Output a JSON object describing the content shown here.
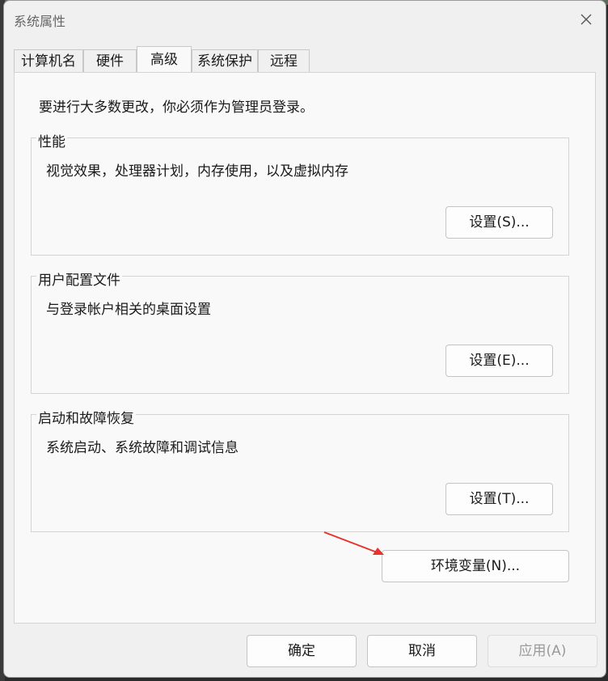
{
  "window": {
    "title": "系统属性",
    "close_icon": "close-icon"
  },
  "tabs": [
    {
      "label": "计算机名",
      "active": false
    },
    {
      "label": "硬件",
      "active": false
    },
    {
      "label": "高级",
      "active": true
    },
    {
      "label": "系统保护",
      "active": false
    },
    {
      "label": "远程",
      "active": false
    }
  ],
  "advanced": {
    "intro": "要进行大多数更改，你必须作为管理员登录。",
    "performance": {
      "label": "性能",
      "description": "视觉效果，处理器计划，内存使用，以及虚拟内存",
      "button": "设置(S)..."
    },
    "user_profiles": {
      "label": "用户配置文件",
      "description": "与登录帐户相关的桌面设置",
      "button": "设置(E)..."
    },
    "startup_recovery": {
      "label": "启动和故障恢复",
      "description": "系统启动、系统故障和调试信息",
      "button": "设置(T)..."
    },
    "env_button": "环境变量(N)..."
  },
  "footer": {
    "ok": "确定",
    "cancel": "取消",
    "apply": "应用(A)",
    "apply_enabled": false
  },
  "colors": {
    "annotation_arrow": "#e8322b"
  }
}
